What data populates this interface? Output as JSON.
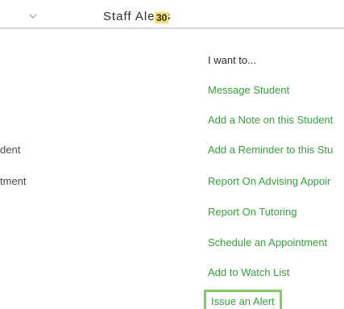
{
  "topbar": {
    "title": "Staff Alerts",
    "count": "30"
  },
  "left": {
    "line1": "dent",
    "line2": "tment"
  },
  "menu": {
    "header": "I want to...",
    "items": [
      "Message Student",
      "Add a Note on this Student",
      "Add a Reminder to this Stu",
      "Report On Advising Appoir",
      "Report On Tutoring",
      "Schedule an Appointment",
      "Add to Watch List"
    ],
    "highlighted": "Issue an Alert"
  },
  "colors": {
    "link": "#35a13d",
    "highlight_border": "#7ccf5c",
    "count_badge": "#f2df76"
  }
}
